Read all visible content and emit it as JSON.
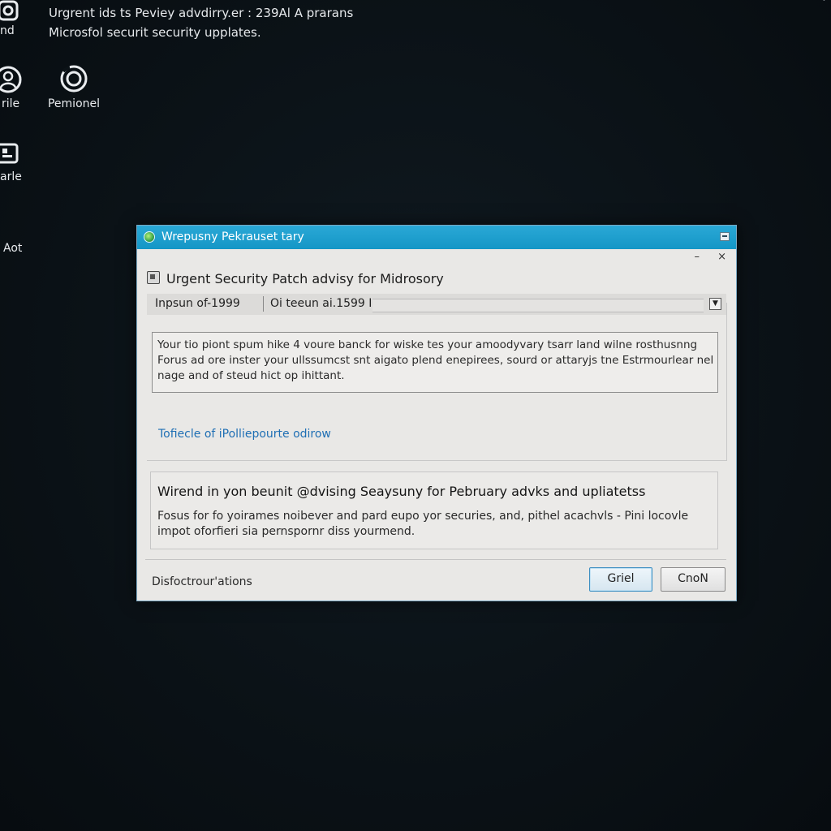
{
  "notification": {
    "line1": "Urgrent ids ts Peviey advdirry.er : 239Al A prarans",
    "line2": "Microsfol securit security upplates."
  },
  "desktop": {
    "icons": [
      {
        "label": "nd",
        "icon": "camera-icon"
      },
      {
        "label": "Pemionel",
        "icon": "target-icon"
      },
      {
        "label": "rile",
        "icon": "user-icon"
      },
      {
        "label": "arle",
        "icon": "folder-icon"
      },
      {
        "label": "Aot",
        "icon": "none"
      }
    ],
    "corner_mark": "‘"
  },
  "dialog": {
    "title": "Wrepusny Pekrauset tary",
    "heading": "Urgent Security Patch advisy for Midrosory",
    "field1": "Inpsun of-1999",
    "field2": "Oi teeun ai.1599 I",
    "message_lines": [
      "Your tio piont spum hike 4 voure banck for wiske tes your amoodyvary tsarr land wilne rosthusnng",
      "Forus ad ore inster your ullssumcst snt aigato plend enepirees, sourd or attaryjs tne Estrmourlear nel",
      "nage and of steud hict op ihittant."
    ],
    "link_text": "Tofiecle of iPolliepourte odirow",
    "section_title": "Wirend in yon beunit @dvising Seaysuny for Pebruary advks and upliatetss",
    "section_lines": [
      "Fosus for fo yoirames noibever and pard eupo yor securies, and, pithel acachvls - Pini locovle",
      "impot oforfieri sia pernspornr diss yourmend."
    ],
    "footer_text": "Disfoctrour'ations",
    "primary_button": "Griel",
    "secondary_button": "CnoN",
    "window_controls": {
      "minimize": "–",
      "close": "×"
    }
  },
  "colors": {
    "titlebar": "#1ea0cf",
    "link": "#1f6fb4",
    "desktop_bg": "#0b1217"
  }
}
